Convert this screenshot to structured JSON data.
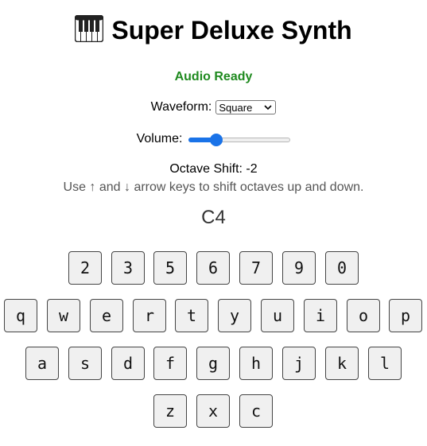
{
  "title": "Super Deluxe Synth",
  "title_icon": "piano-keyboard-icon",
  "status": {
    "text": "Audio Ready",
    "color": "#1f8a1f"
  },
  "waveform": {
    "label": "Waveform:",
    "selected": "Square"
  },
  "volume": {
    "label": "Volume:",
    "value_fraction": 0.27,
    "accent": "#1a73e8"
  },
  "octave": {
    "text": "Octave Shift: -2"
  },
  "hint": "Use ↑ and ↓ arrow keys to shift octaves up and down.",
  "current_note": "C4",
  "keyboard": {
    "row1": [
      "2",
      "3",
      "5",
      "6",
      "7",
      "9",
      "0"
    ],
    "row2": [
      "q",
      "w",
      "e",
      "r",
      "t",
      "y",
      "u",
      "i",
      "o",
      "p"
    ],
    "row3": [
      "a",
      "s",
      "d",
      "f",
      "g",
      "h",
      "j",
      "k",
      "l"
    ],
    "row4": [
      "z",
      "x",
      "c"
    ]
  }
}
